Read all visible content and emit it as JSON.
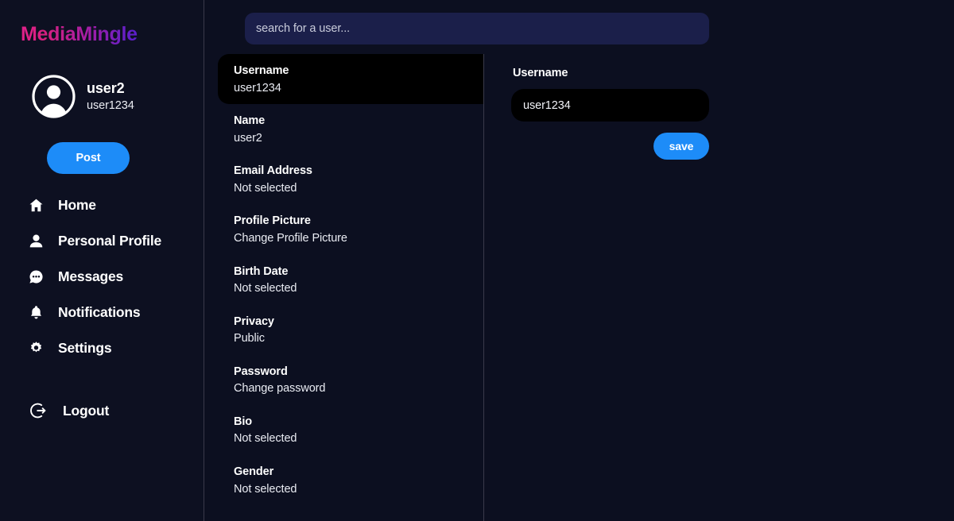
{
  "brand": {
    "name": "MediaMingle"
  },
  "profile": {
    "avatar_icon": "user-avatar-icon",
    "name": "user2",
    "handle": "user1234"
  },
  "post_button": {
    "label": "Post"
  },
  "nav": {
    "items": [
      {
        "label": "Home",
        "icon": "home-icon"
      },
      {
        "label": "Personal Profile",
        "icon": "person-icon"
      },
      {
        "label": "Messages",
        "icon": "chat-bubble-icon"
      },
      {
        "label": "Notifications",
        "icon": "bell-icon"
      },
      {
        "label": "Settings",
        "icon": "gear-icon"
      }
    ],
    "logout": {
      "label": "Logout",
      "icon": "logout-icon"
    }
  },
  "search": {
    "value": "",
    "placeholder": "search for a user..."
  },
  "settings_list": {
    "items": [
      {
        "label": "Username",
        "value": "user1234",
        "active": true
      },
      {
        "label": "Name",
        "value": "user2",
        "active": false
      },
      {
        "label": "Email Address",
        "value": "Not selected",
        "active": false
      },
      {
        "label": "Profile Picture",
        "value": "Change Profile Picture",
        "active": false
      },
      {
        "label": "Birth Date",
        "value": "Not selected",
        "active": false
      },
      {
        "label": "Privacy",
        "value": "Public",
        "active": false
      },
      {
        "label": "Password",
        "value": "Change password",
        "active": false
      },
      {
        "label": "Bio",
        "value": "Not selected",
        "active": false
      },
      {
        "label": "Gender",
        "value": "Not selected",
        "active": false
      }
    ]
  },
  "detail_panel": {
    "label": "Username",
    "input_value": "user1234",
    "input_placeholder": "",
    "save_label": "save"
  },
  "colors": {
    "page_background": "#0c0f20",
    "sidebar_background": "#0d1021",
    "divider": "#3a3a4a",
    "accent_blue": "#1d8cf8",
    "brand_gradient_start": "#e0218a",
    "brand_gradient_end": "#5a1fcc",
    "search_field": "#1b1f4a",
    "active_card": "#000000",
    "text_primary": "#ffffff",
    "text_secondary": "#eaecf3"
  }
}
